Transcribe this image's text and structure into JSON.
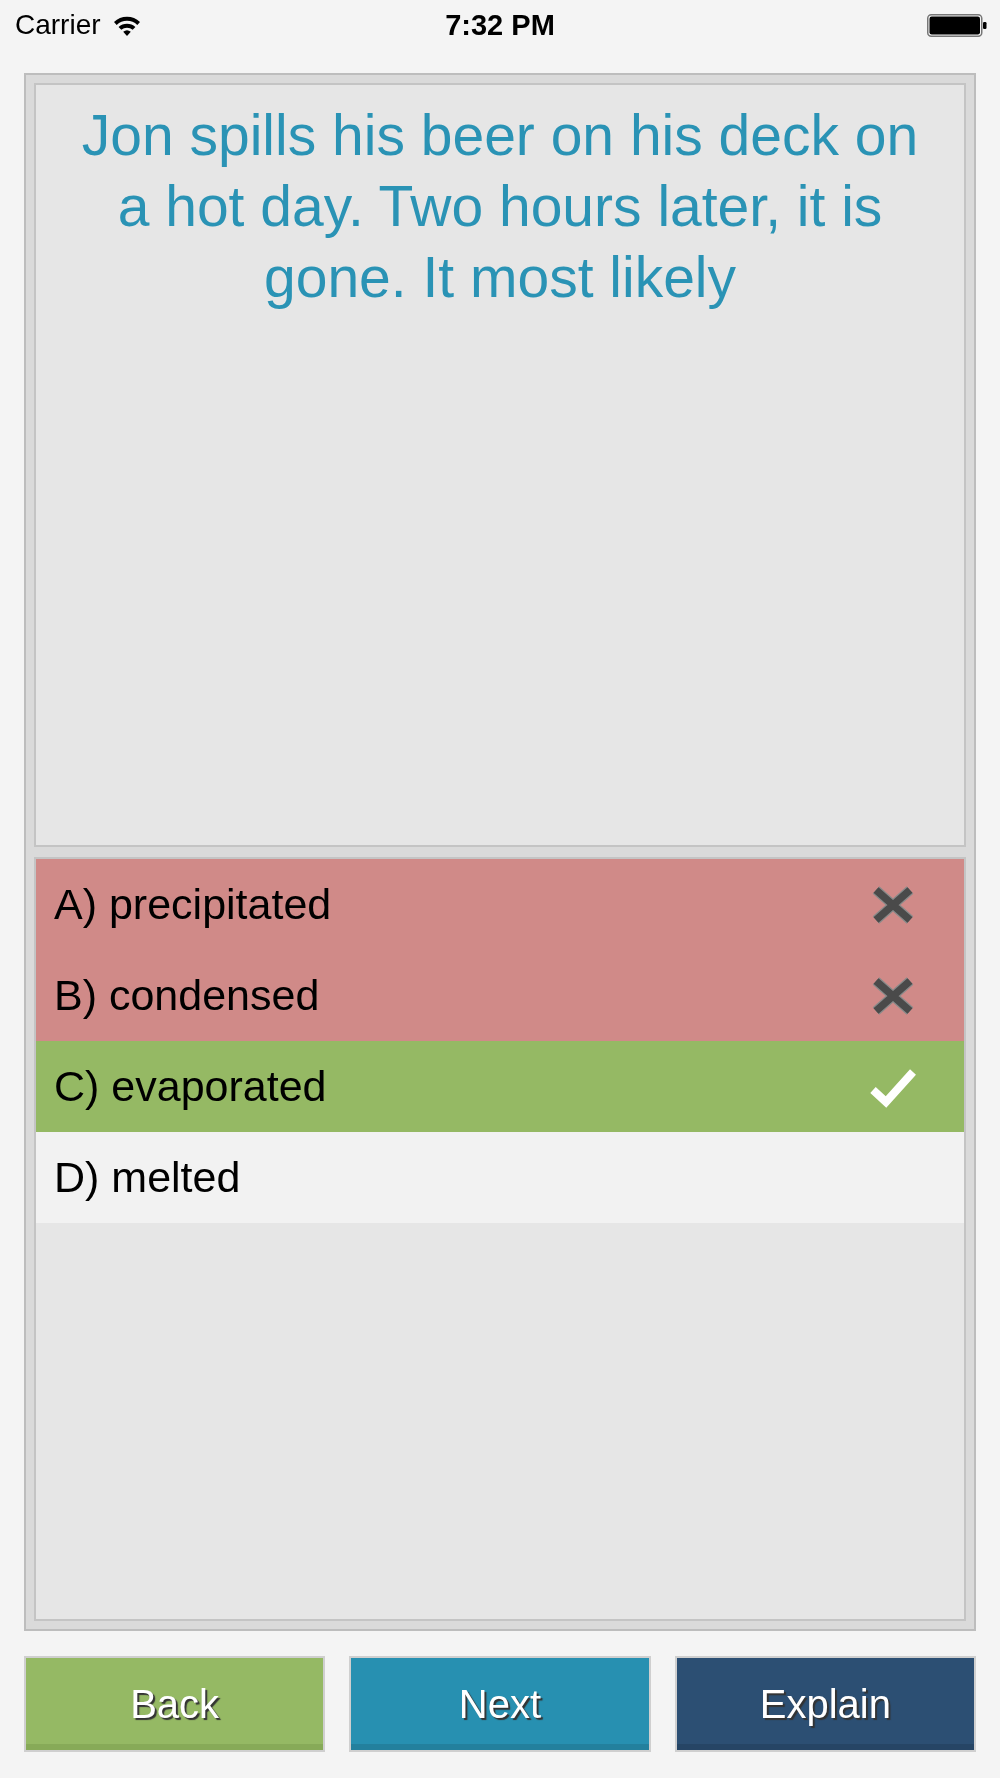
{
  "status_bar": {
    "carrier": "Carrier",
    "time": "7:32 PM"
  },
  "question": {
    "text": "Jon spills his beer on his deck on a hot day. Two hours later, it is gone. It most likely"
  },
  "answers": [
    {
      "label": "A) precipitated",
      "selected": true,
      "correct": false
    },
    {
      "label": "B) condensed",
      "selected": true,
      "correct": false
    },
    {
      "label": "C) evaporated",
      "selected": true,
      "correct": true
    },
    {
      "label": "D) melted",
      "selected": false,
      "correct": false
    }
  ],
  "buttons": [
    {
      "label": "Back",
      "kind": "back"
    },
    {
      "label": "Next",
      "kind": "next"
    },
    {
      "label": "Explain",
      "kind": "explain"
    }
  ]
}
